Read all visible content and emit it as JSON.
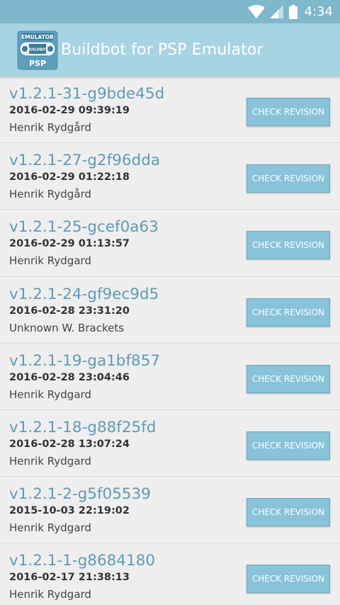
{
  "status_bar": {
    "time": "4:34",
    "icons": [
      "wifi-icon",
      "signal-icon",
      "battery-icon"
    ]
  },
  "app_bar": {
    "title": "Buildbot for PSP Emulator",
    "logo": {
      "top_text": "EMULATOR",
      "middle_text": "BUILDBOT",
      "bottom_text": "PSP"
    }
  },
  "colors": {
    "status_bar": "#7fb7cc",
    "app_bar": "#a8d3e3",
    "revision_text": "#5f9bb5",
    "button": "#88c3d9"
  },
  "builds": [
    {
      "revision": "v1.2.1-31-g9bde45d",
      "date": "2016-02-29 09:39:19",
      "author": "Henrik Rydgård",
      "button": "CHECK REVISION"
    },
    {
      "revision": "v1.2.1-27-g2f96dda",
      "date": "2016-02-29 01:22:18",
      "author": "Henrik Rydgård",
      "button": "CHECK REVISION"
    },
    {
      "revision": "v1.2.1-25-gcef0a63",
      "date": "2016-02-29 01:13:57",
      "author": "Henrik Rydgard",
      "button": "CHECK REVISION"
    },
    {
      "revision": "v1.2.1-24-gf9ec9d5",
      "date": "2016-02-28 23:31:20",
      "author": "Unknown W. Brackets",
      "button": "CHECK REVISION"
    },
    {
      "revision": "v1.2.1-19-ga1bf857",
      "date": "2016-02-28 23:04:46",
      "author": "Henrik Rydgard",
      "button": "CHECK REVISION"
    },
    {
      "revision": "v1.2.1-18-g88f25fd",
      "date": "2016-02-28 13:07:24",
      "author": "Henrik Rydgard",
      "button": "CHECK REVISION"
    },
    {
      "revision": "v1.2.1-2-g5f05539",
      "date": "2015-10-03 22:19:02",
      "author": "Henrik Rydgard",
      "button": "CHECK REVISION"
    },
    {
      "revision": "v1.2.1-1-g8684180",
      "date": "2016-02-17 21:38:13",
      "author": "Henrik Rydgard",
      "button": "CHECK REVISION"
    }
  ]
}
